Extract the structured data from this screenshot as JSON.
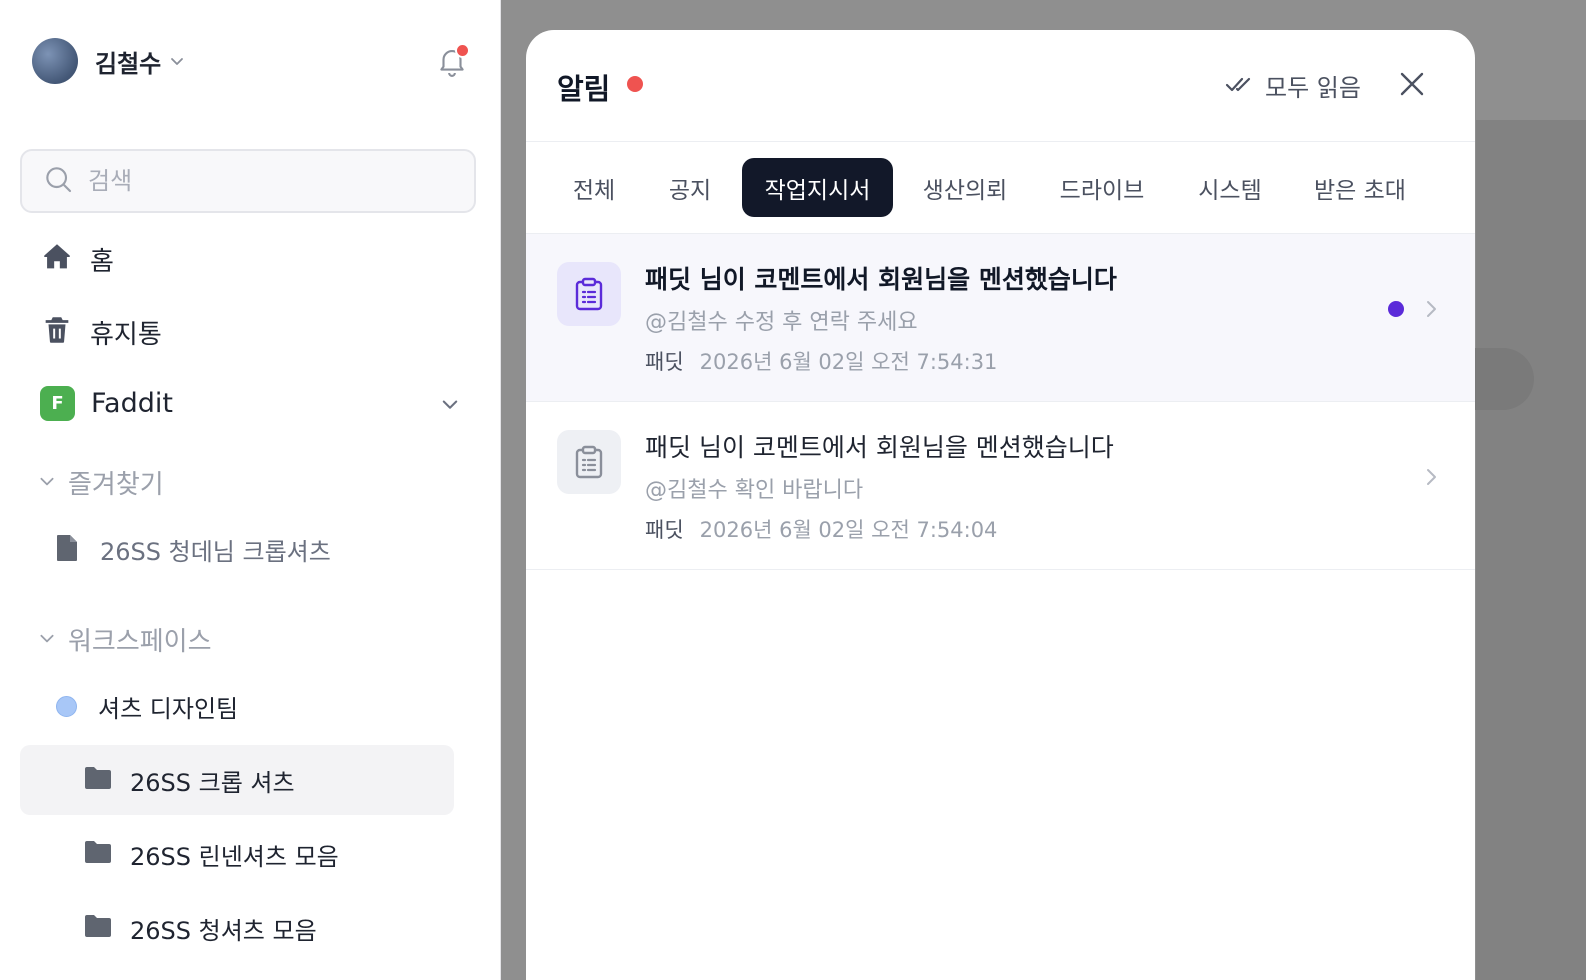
{
  "sidebar": {
    "user": {
      "name": "김철수"
    },
    "search": {
      "placeholder": "검색"
    },
    "nav": {
      "home": "홈",
      "trash": "휴지통"
    },
    "workspace": {
      "badge": "F",
      "name": "Faddit",
      "badge_color": "#4caf50"
    },
    "favorites": {
      "title": "즐겨찾기",
      "items": [
        "26SS 청데님 크롭셔츠"
      ]
    },
    "workspace_section": {
      "title": "워크스페이스",
      "team": "셔츠 디자인팀",
      "folders": [
        "26SS 크롭 셔츠",
        "26SS 린넨셔츠 모음",
        "26SS 청셔츠 모음"
      ]
    }
  },
  "modal": {
    "title": "알림",
    "mark_all_read": "모두 읽음",
    "tabs": [
      "전체",
      "공지",
      "작업지시서",
      "생산의뢰",
      "드라이브",
      "시스템",
      "받은 초대"
    ],
    "active_tab": "작업지시서",
    "notifications": [
      {
        "title": "패딧 님이 코멘트에서 회원님을 멘션했습니다",
        "body": "@김철수 수정 후 연락 주세요",
        "sender": "패딧",
        "time": "2026년 6월 02일 오전 7:54:31",
        "unread": true
      },
      {
        "title": "패딧 님이 코멘트에서 회원님을 멘션했습니다",
        "body": "@김철수 확인 바랍니다",
        "sender": "패딧",
        "time": "2026년 6월 02일 오전 7:54:04",
        "unread": false
      }
    ]
  },
  "colors": {
    "accent": "#121829",
    "unread_dot": "#5b2bd9",
    "badge_red": "#ef5350"
  },
  "icons": [
    "bell-icon",
    "search-icon",
    "home-icon",
    "trash-icon",
    "chevron-down-icon",
    "document-icon",
    "folder-icon",
    "double-check-icon",
    "close-icon",
    "clipboard-icon",
    "chevron-right-icon"
  ]
}
